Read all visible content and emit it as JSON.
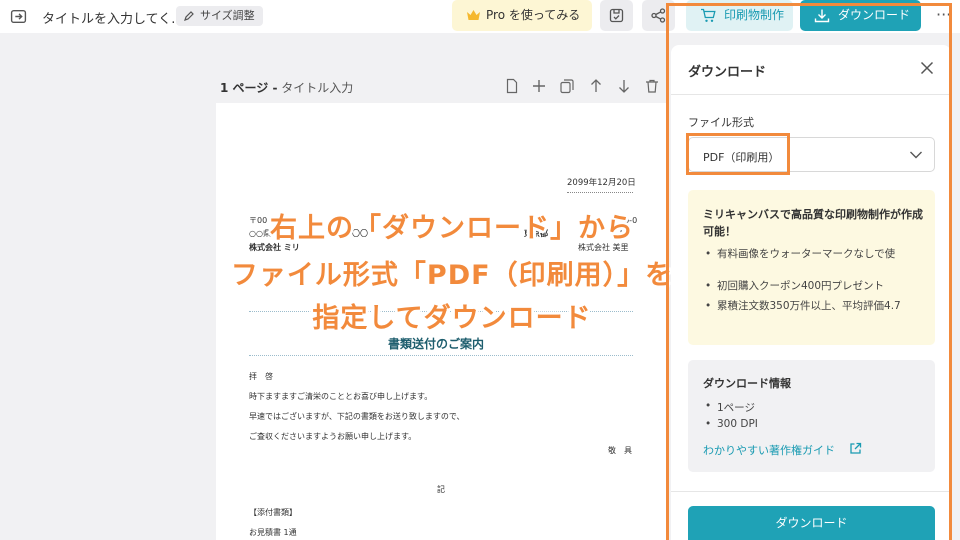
{
  "topbar": {
    "title": "タイトルを入力してく...",
    "resize_label": "サイズ調整",
    "pro_label": "Pro を使ってみる",
    "print_label": "印刷物制作",
    "download_label": "ダウンロード",
    "more_label": "···"
  },
  "page": {
    "number": "1 ページ -",
    "title_placeholder": "タイトル入力"
  },
  "document": {
    "date": "2099年12月20日",
    "postal_left": "〒00",
    "address_left": "○○県",
    "address_left_tail": "ル〇〇",
    "company_left": "株式会社 ミリ",
    "postal_right": "〒10-0",
    "address_right": "東京都",
    "address_right_tail": "00",
    "company_right": "株式会社 美里",
    "heading": "書類送付のご案内",
    "greeting": "拝　啓",
    "body_line1": "時下ますますご清栄のこととお喜び申し上げます。",
    "body_line2": "早速ではございますが、下記の書類をお送り致しますので、",
    "body_line3": "ご査収くださいますようお願い申し上げます。",
    "closing": "敬　具",
    "ki": "記",
    "attachments_header": "【添付書類】",
    "attachment1": "お見積書 1通"
  },
  "overlay": {
    "line1": "右上の「ダウンロード」から",
    "line2": "ファイル形式「PDF（印刷用）」を",
    "line3": "指定してダウンロード"
  },
  "panel": {
    "title": "ダウンロード",
    "file_format_label": "ファイル形式",
    "file_format_value": "PDF（印刷用）",
    "promo_title": "ミリキャンバスで高品質な印刷物制作が作成可能！",
    "promo_items": [
      "有料画像をウォーターマークなしで使",
      "初回購入クーポン400円プレゼント",
      "累積注文数350万件以上、平均評価4.7"
    ],
    "info_title": "ダウンロード情報",
    "info_items": [
      "1ページ",
      "300 DPI"
    ],
    "info_link": "わかりやすい著作権ガイド",
    "download_button": "ダウンロード"
  },
  "colors": {
    "accent": "#1fa2b6",
    "highlight": "#f28a3c",
    "promo_bg": "#fdf9e1"
  }
}
